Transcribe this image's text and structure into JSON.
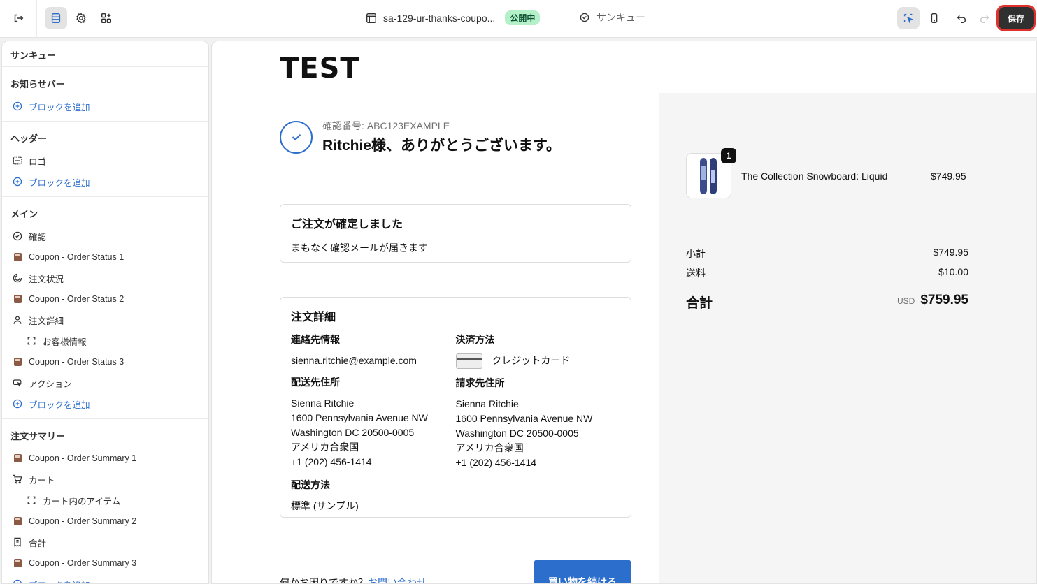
{
  "topbar": {
    "page_title": "sa-129-ur-thanks-coupo...",
    "status_badge": "公開中",
    "page_selector": "サンキュー",
    "save_label": "保存"
  },
  "sidebar": {
    "title": "サンキュー",
    "sections": {
      "announcement": {
        "heading": "お知らせバー",
        "add": "ブロックを追加"
      },
      "header": {
        "heading": "ヘッダー",
        "logo": "ロゴ",
        "add": "ブロックを追加"
      },
      "main": {
        "heading": "メイン",
        "items": [
          "確認",
          "Coupon - Order Status 1",
          "注文状況",
          "Coupon - Order Status 2",
          "注文詳細",
          "お客様情報",
          "Coupon - Order Status 3",
          "アクション"
        ],
        "add": "ブロックを追加"
      },
      "summary": {
        "heading": "注文サマリー",
        "items": [
          "Coupon - Order Summary 1",
          "カート",
          "カート内のアイテム",
          "Coupon - Order Summary 2",
          "合計",
          "Coupon - Order Summary 3"
        ],
        "add": "ブロックを追加"
      }
    }
  },
  "preview": {
    "logo": "TEST",
    "confirmation_number": "確認番号: ABC123EXAMPLE",
    "thanks": "Ritchie様、ありがとうございます。",
    "confirmed_card": {
      "title": "ご注文が確定しました",
      "sub": "まもなく確認メールが届きます"
    },
    "details": {
      "title": "注文詳細",
      "contact_label": "連絡先情報",
      "contact": "sienna.ritchie@example.com",
      "payment_label": "決済方法",
      "payment": "クレジットカード",
      "shipping_addr_label": "配送先住所",
      "shipping_addr": [
        "Sienna Ritchie",
        "1600 Pennsylvania Avenue NW",
        "Washington DC 20500-0005",
        "アメリカ合衆国",
        "+1 (202) 456-1414"
      ],
      "billing_addr_label": "請求先住所",
      "billing_addr": [
        "Sienna Ritchie",
        "1600 Pennsylvania Avenue NW",
        "Washington DC 20500-0005",
        "アメリカ合衆国",
        "+1 (202) 456-1414"
      ],
      "shipping_method_label": "配送方法",
      "shipping_method": "標準 (サンプル)"
    },
    "help_text": "何かお困りですか？",
    "help_link": "お問い合わせ",
    "continue_button": "買い物を続ける",
    "order": {
      "product_name": "The Collection Snowboard: Liquid",
      "product_price": "$749.95",
      "quantity": "1",
      "subtotal_label": "小計",
      "subtotal": "$749.95",
      "shipping_label": "送料",
      "shipping": "$10.00",
      "total_label": "合計",
      "currency": "USD",
      "total": "$759.95"
    }
  }
}
